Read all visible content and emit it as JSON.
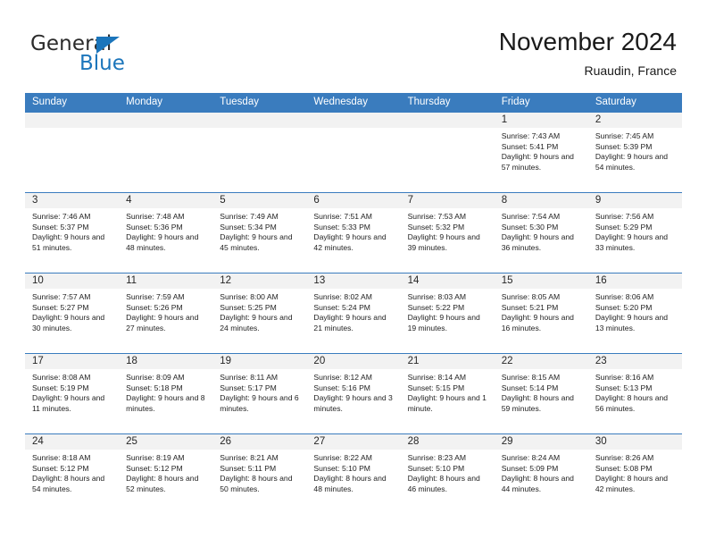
{
  "brand": {
    "word_one": "General",
    "word_two": "Blue",
    "triangle_icon": "blue-triangle-logo-mark",
    "accent_color": "#1b75bb"
  },
  "header": {
    "title": "November 2024",
    "subtitle": "Ruaudin, France"
  },
  "colors": {
    "header_blue": "#3a7cbe",
    "daynum_band": "#f2f2f2",
    "text": "#222222"
  },
  "calendar": {
    "day_headers": [
      "Sunday",
      "Monday",
      "Tuesday",
      "Wednesday",
      "Thursday",
      "Friday",
      "Saturday"
    ],
    "weeks": [
      [
        {
          "day": "",
          "sunrise": "",
          "sunset": "",
          "daylight": ""
        },
        {
          "day": "",
          "sunrise": "",
          "sunset": "",
          "daylight": ""
        },
        {
          "day": "",
          "sunrise": "",
          "sunset": "",
          "daylight": ""
        },
        {
          "day": "",
          "sunrise": "",
          "sunset": "",
          "daylight": ""
        },
        {
          "day": "",
          "sunrise": "",
          "sunset": "",
          "daylight": ""
        },
        {
          "day": "1",
          "sunrise": "Sunrise: 7:43 AM",
          "sunset": "Sunset: 5:41 PM",
          "daylight": "Daylight: 9 hours and 57 minutes."
        },
        {
          "day": "2",
          "sunrise": "Sunrise: 7:45 AM",
          "sunset": "Sunset: 5:39 PM",
          "daylight": "Daylight: 9 hours and 54 minutes."
        }
      ],
      [
        {
          "day": "3",
          "sunrise": "Sunrise: 7:46 AM",
          "sunset": "Sunset: 5:37 PM",
          "daylight": "Daylight: 9 hours and 51 minutes."
        },
        {
          "day": "4",
          "sunrise": "Sunrise: 7:48 AM",
          "sunset": "Sunset: 5:36 PM",
          "daylight": "Daylight: 9 hours and 48 minutes."
        },
        {
          "day": "5",
          "sunrise": "Sunrise: 7:49 AM",
          "sunset": "Sunset: 5:34 PM",
          "daylight": "Daylight: 9 hours and 45 minutes."
        },
        {
          "day": "6",
          "sunrise": "Sunrise: 7:51 AM",
          "sunset": "Sunset: 5:33 PM",
          "daylight": "Daylight: 9 hours and 42 minutes."
        },
        {
          "day": "7",
          "sunrise": "Sunrise: 7:53 AM",
          "sunset": "Sunset: 5:32 PM",
          "daylight": "Daylight: 9 hours and 39 minutes."
        },
        {
          "day": "8",
          "sunrise": "Sunrise: 7:54 AM",
          "sunset": "Sunset: 5:30 PM",
          "daylight": "Daylight: 9 hours and 36 minutes."
        },
        {
          "day": "9",
          "sunrise": "Sunrise: 7:56 AM",
          "sunset": "Sunset: 5:29 PM",
          "daylight": "Daylight: 9 hours and 33 minutes."
        }
      ],
      [
        {
          "day": "10",
          "sunrise": "Sunrise: 7:57 AM",
          "sunset": "Sunset: 5:27 PM",
          "daylight": "Daylight: 9 hours and 30 minutes."
        },
        {
          "day": "11",
          "sunrise": "Sunrise: 7:59 AM",
          "sunset": "Sunset: 5:26 PM",
          "daylight": "Daylight: 9 hours and 27 minutes."
        },
        {
          "day": "12",
          "sunrise": "Sunrise: 8:00 AM",
          "sunset": "Sunset: 5:25 PM",
          "daylight": "Daylight: 9 hours and 24 minutes."
        },
        {
          "day": "13",
          "sunrise": "Sunrise: 8:02 AM",
          "sunset": "Sunset: 5:24 PM",
          "daylight": "Daylight: 9 hours and 21 minutes."
        },
        {
          "day": "14",
          "sunrise": "Sunrise: 8:03 AM",
          "sunset": "Sunset: 5:22 PM",
          "daylight": "Daylight: 9 hours and 19 minutes."
        },
        {
          "day": "15",
          "sunrise": "Sunrise: 8:05 AM",
          "sunset": "Sunset: 5:21 PM",
          "daylight": "Daylight: 9 hours and 16 minutes."
        },
        {
          "day": "16",
          "sunrise": "Sunrise: 8:06 AM",
          "sunset": "Sunset: 5:20 PM",
          "daylight": "Daylight: 9 hours and 13 minutes."
        }
      ],
      [
        {
          "day": "17",
          "sunrise": "Sunrise: 8:08 AM",
          "sunset": "Sunset: 5:19 PM",
          "daylight": "Daylight: 9 hours and 11 minutes."
        },
        {
          "day": "18",
          "sunrise": "Sunrise: 8:09 AM",
          "sunset": "Sunset: 5:18 PM",
          "daylight": "Daylight: 9 hours and 8 minutes."
        },
        {
          "day": "19",
          "sunrise": "Sunrise: 8:11 AM",
          "sunset": "Sunset: 5:17 PM",
          "daylight": "Daylight: 9 hours and 6 minutes."
        },
        {
          "day": "20",
          "sunrise": "Sunrise: 8:12 AM",
          "sunset": "Sunset: 5:16 PM",
          "daylight": "Daylight: 9 hours and 3 minutes."
        },
        {
          "day": "21",
          "sunrise": "Sunrise: 8:14 AM",
          "sunset": "Sunset: 5:15 PM",
          "daylight": "Daylight: 9 hours and 1 minute."
        },
        {
          "day": "22",
          "sunrise": "Sunrise: 8:15 AM",
          "sunset": "Sunset: 5:14 PM",
          "daylight": "Daylight: 8 hours and 59 minutes."
        },
        {
          "day": "23",
          "sunrise": "Sunrise: 8:16 AM",
          "sunset": "Sunset: 5:13 PM",
          "daylight": "Daylight: 8 hours and 56 minutes."
        }
      ],
      [
        {
          "day": "24",
          "sunrise": "Sunrise: 8:18 AM",
          "sunset": "Sunset: 5:12 PM",
          "daylight": "Daylight: 8 hours and 54 minutes."
        },
        {
          "day": "25",
          "sunrise": "Sunrise: 8:19 AM",
          "sunset": "Sunset: 5:12 PM",
          "daylight": "Daylight: 8 hours and 52 minutes."
        },
        {
          "day": "26",
          "sunrise": "Sunrise: 8:21 AM",
          "sunset": "Sunset: 5:11 PM",
          "daylight": "Daylight: 8 hours and 50 minutes."
        },
        {
          "day": "27",
          "sunrise": "Sunrise: 8:22 AM",
          "sunset": "Sunset: 5:10 PM",
          "daylight": "Daylight: 8 hours and 48 minutes."
        },
        {
          "day": "28",
          "sunrise": "Sunrise: 8:23 AM",
          "sunset": "Sunset: 5:10 PM",
          "daylight": "Daylight: 8 hours and 46 minutes."
        },
        {
          "day": "29",
          "sunrise": "Sunrise: 8:24 AM",
          "sunset": "Sunset: 5:09 PM",
          "daylight": "Daylight: 8 hours and 44 minutes."
        },
        {
          "day": "30",
          "sunrise": "Sunrise: 8:26 AM",
          "sunset": "Sunset: 5:08 PM",
          "daylight": "Daylight: 8 hours and 42 minutes."
        }
      ]
    ]
  }
}
